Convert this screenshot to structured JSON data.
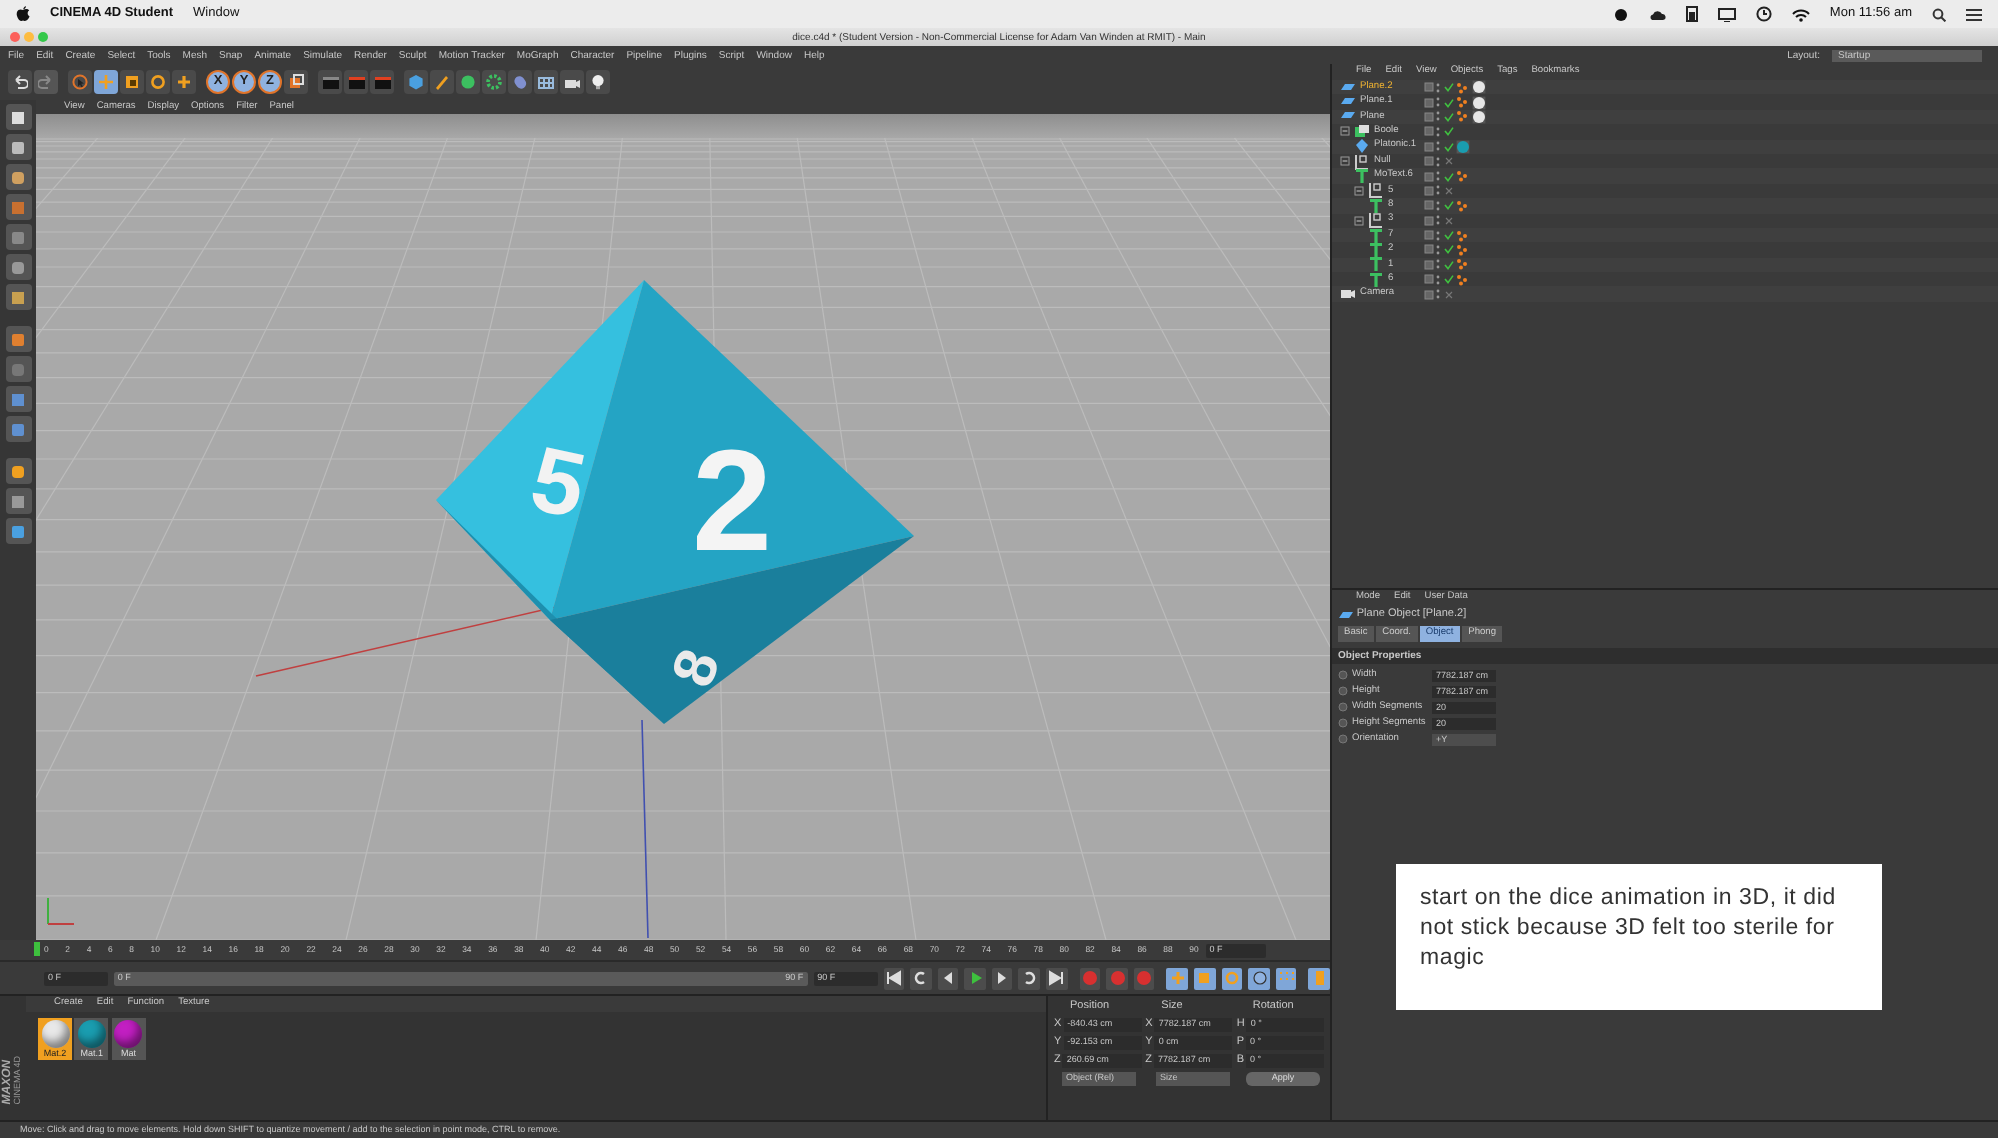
{
  "mac_menubar": {
    "app_name": "CINEMA 4D Student",
    "menus": [
      "Window"
    ],
    "clock": "Mon 11:56 am"
  },
  "window": {
    "title": "dice.c4d * (Student Version - Non-Commercial License for Adam Van Winden at RMIT) - Main"
  },
  "main_menu": [
    "File",
    "Edit",
    "Create",
    "Select",
    "Tools",
    "Mesh",
    "Snap",
    "Animate",
    "Simulate",
    "Render",
    "Sculpt",
    "Motion Tracker",
    "MoGraph",
    "Character",
    "Pipeline",
    "Plugins",
    "Script",
    "Window",
    "Help"
  ],
  "layout": {
    "label": "Layout:",
    "value": "Startup"
  },
  "toolbar": {
    "tools": [
      {
        "kind": "select",
        "active": false
      },
      {
        "kind": "move",
        "active": true
      },
      {
        "kind": "scale",
        "active": false
      },
      {
        "kind": "rotate",
        "active": false
      },
      {
        "kind": "transform",
        "active": false
      }
    ],
    "axis_lock": [
      {
        "label": "X",
        "on": true
      },
      {
        "label": "Y",
        "on": true
      },
      {
        "label": "Z",
        "on": true
      }
    ]
  },
  "viewport": {
    "menu": [
      "View",
      "Cameras",
      "Display",
      "Options",
      "Filter",
      "Panel"
    ],
    "dice_faces": [
      "5",
      "2",
      "8"
    ]
  },
  "object_manager": {
    "menu": [
      "File",
      "Edit",
      "View",
      "Objects",
      "Tags",
      "Bookmarks"
    ],
    "objects": [
      {
        "name": "Plane.2",
        "kind": "plane",
        "selected": true,
        "enabled": true,
        "tags": [
          {
            "kind": "phong"
          },
          {
            "kind": "material",
            "color": "#e6e6e6"
          }
        ]
      },
      {
        "name": "Plane.1",
        "kind": "plane",
        "selected": false,
        "enabled": true,
        "tags": [
          {
            "kind": "phong"
          },
          {
            "kind": "material",
            "color": "#e6e6e6"
          }
        ]
      },
      {
        "name": "Plane",
        "kind": "plane",
        "selected": false,
        "enabled": true,
        "tags": [
          {
            "kind": "phong"
          },
          {
            "kind": "material",
            "color": "#e6e6e6"
          }
        ]
      },
      {
        "name": "Boole",
        "kind": "boole",
        "selected": false,
        "enabled": true,
        "expanded": true,
        "children": [
          {
            "name": "Platonic.1",
            "kind": "platonic",
            "selected": false,
            "enabled": true,
            "tags": [
              {
                "kind": "material",
                "color": "#1a9db0"
              }
            ]
          }
        ]
      },
      {
        "name": "Null",
        "kind": "null",
        "selected": false,
        "enabled": false,
        "expanded": true,
        "children": [
          {
            "name": "MoText.6",
            "kind": "text",
            "selected": false,
            "enabled": true,
            "tags": [
              {
                "kind": "phong"
              }
            ]
          },
          {
            "name": "5",
            "kind": "null",
            "selected": false,
            "enabled": false,
            "expanded": true,
            "children": [
              {
                "name": "8",
                "kind": "text",
                "selected": false,
                "enabled": true,
                "tags": [
                  {
                    "kind": "phong"
                  }
                ]
              }
            ]
          },
          {
            "name": "3",
            "kind": "null",
            "selected": false,
            "enabled": false,
            "expanded": true,
            "children": [
              {
                "name": "7",
                "kind": "text",
                "selected": false,
                "enabled": true,
                "tags": [
                  {
                    "kind": "phong"
                  }
                ]
              },
              {
                "name": "2",
                "kind": "text",
                "selected": false,
                "enabled": true,
                "tags": [
                  {
                    "kind": "phong"
                  }
                ]
              },
              {
                "name": "1",
                "kind": "text",
                "selected": false,
                "enabled": true,
                "tags": [
                  {
                    "kind": "phong"
                  }
                ]
              },
              {
                "name": "6",
                "kind": "text",
                "selected": false,
                "enabled": true,
                "tags": [
                  {
                    "kind": "phong"
                  }
                ]
              }
            ]
          }
        ]
      },
      {
        "name": "Camera",
        "kind": "camera",
        "selected": false,
        "enabled": false
      }
    ]
  },
  "attributes": {
    "menu": [
      "Mode",
      "Edit",
      "User Data"
    ],
    "object_title": "Plane Object [Plane.2]",
    "tabs": [
      {
        "label": "Basic",
        "selected": false
      },
      {
        "label": "Coord.",
        "selected": false
      },
      {
        "label": "Object",
        "selected": true
      },
      {
        "label": "Phong",
        "selected": false
      }
    ],
    "section": "Object Properties",
    "fields": [
      {
        "label": "Width",
        "value": "7782.187 cm",
        "kind": "number"
      },
      {
        "label": "Height",
        "value": "7782.187 cm",
        "kind": "number"
      },
      {
        "label": "Width Segments",
        "value": "20",
        "kind": "number"
      },
      {
        "label": "Height Segments",
        "value": "20",
        "kind": "number"
      },
      {
        "label": "Orientation",
        "value": "+Y",
        "kind": "dropdown"
      }
    ]
  },
  "note": {
    "text": "start on the dice animation in 3D, it did not stick because 3D felt too sterile for magic"
  },
  "timeline": {
    "ticks": [
      "0",
      "2",
      "4",
      "6",
      "8",
      "10",
      "12",
      "14",
      "16",
      "18",
      "20",
      "22",
      "24",
      "26",
      "28",
      "30",
      "32",
      "34",
      "36",
      "38",
      "40",
      "42",
      "44",
      "46",
      "48",
      "50",
      "52",
      "54",
      "56",
      "58",
      "60",
      "62",
      "64",
      "66",
      "68",
      "70",
      "72",
      "74",
      "76",
      "78",
      "80",
      "82",
      "84",
      "86",
      "88",
      "90"
    ],
    "current_frame": "0 F",
    "start_field": "0 F",
    "range_bar": {
      "level": 1
    },
    "range_start": "0 F",
    "range_end": "90 F",
    "end_field": "90 F"
  },
  "material_manager": {
    "menu": [
      "Create",
      "Edit",
      "Function",
      "Texture"
    ],
    "materials": [
      {
        "name": "Mat.2",
        "color": "#e8e8e8",
        "selected": true
      },
      {
        "name": "Mat.1",
        "color": "#1a9db0",
        "selected": false
      },
      {
        "name": "Mat",
        "color": "#c21fc2",
        "selected": false
      }
    ]
  },
  "logo": {
    "brand": "MAXON",
    "product": "CINEMA 4D"
  },
  "coordinates": {
    "headers": [
      "Position",
      "Size",
      "Rotation"
    ],
    "rows": [
      {
        "position_axis": "X",
        "position": "-840.43 cm",
        "size_axis": "X",
        "size": "7782.187 cm",
        "rotation_axis": "H",
        "rotation": "0 °"
      },
      {
        "position_axis": "Y",
        "position": "-92.153 cm",
        "size_axis": "Y",
        "size": "0 cm",
        "rotation_axis": "P",
        "rotation": "0 °"
      },
      {
        "position_axis": "Z",
        "position": "260.69 cm",
        "size_axis": "Z",
        "size": "7782.187 cm",
        "rotation_axis": "B",
        "rotation": "0 °"
      }
    ],
    "position_mode": "Object (Rel)",
    "size_mode": "Size",
    "apply": "Apply"
  },
  "status_bar": "Move: Click and drag to move elements. Hold down SHIFT to quantize movement / add to the selection in point mode, CTRL to remove."
}
